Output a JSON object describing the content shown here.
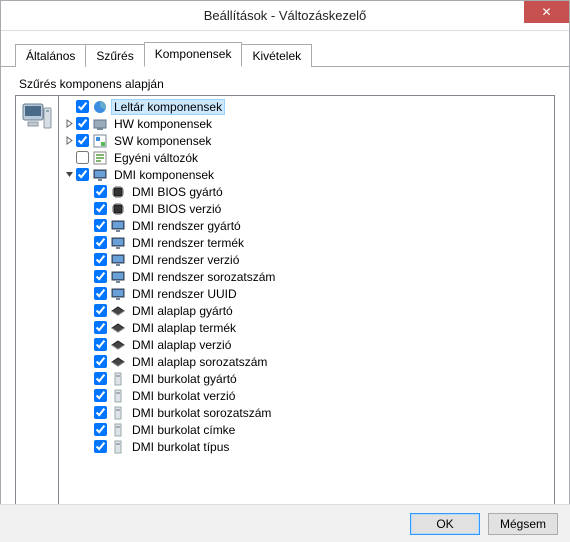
{
  "window": {
    "title": "Beállítások - Változáskezelő",
    "close_label": "✕"
  },
  "tabs": [
    {
      "label": "Általános",
      "active": false
    },
    {
      "label": "Szűrés",
      "active": false
    },
    {
      "label": "Komponensek",
      "active": true
    },
    {
      "label": "Kivételek",
      "active": false
    }
  ],
  "group_label": "Szűrés komponens alapján",
  "tree": [
    {
      "level": 0,
      "expander": "none",
      "checked": true,
      "icon": "pie-icon",
      "label": "Leltár komponensek",
      "selected": true
    },
    {
      "level": 0,
      "expander": "closed",
      "checked": true,
      "icon": "hw-icon",
      "label": "HW komponensek"
    },
    {
      "level": 0,
      "expander": "closed",
      "checked": true,
      "icon": "sw-icon",
      "label": "SW komponensek"
    },
    {
      "level": 0,
      "expander": "none",
      "checked": false,
      "icon": "custom-icon",
      "label": "Egyéni változók"
    },
    {
      "level": 0,
      "expander": "open",
      "checked": true,
      "icon": "monitor-icon",
      "label": "DMI komponensek"
    },
    {
      "level": 1,
      "expander": "none",
      "checked": true,
      "icon": "chip-icon",
      "label": "DMI BIOS gyártó"
    },
    {
      "level": 1,
      "expander": "none",
      "checked": true,
      "icon": "chip-icon",
      "label": "DMI BIOS verzió"
    },
    {
      "level": 1,
      "expander": "none",
      "checked": true,
      "icon": "monitor-icon",
      "label": "DMI rendszer gyártó"
    },
    {
      "level": 1,
      "expander": "none",
      "checked": true,
      "icon": "monitor-icon",
      "label": "DMI rendszer termék"
    },
    {
      "level": 1,
      "expander": "none",
      "checked": true,
      "icon": "monitor-icon",
      "label": "DMI rendszer verzió"
    },
    {
      "level": 1,
      "expander": "none",
      "checked": true,
      "icon": "monitor-icon",
      "label": "DMI rendszer sorozatszám"
    },
    {
      "level": 1,
      "expander": "none",
      "checked": true,
      "icon": "monitor-icon",
      "label": "DMI rendszer UUID"
    },
    {
      "level": 1,
      "expander": "none",
      "checked": true,
      "icon": "board-icon",
      "label": "DMI alaplap gyártó"
    },
    {
      "level": 1,
      "expander": "none",
      "checked": true,
      "icon": "board-icon",
      "label": "DMI alaplap termék"
    },
    {
      "level": 1,
      "expander": "none",
      "checked": true,
      "icon": "board-icon",
      "label": "DMI alaplap verzió"
    },
    {
      "level": 1,
      "expander": "none",
      "checked": true,
      "icon": "board-icon",
      "label": "DMI alaplap sorozatszám"
    },
    {
      "level": 1,
      "expander": "none",
      "checked": true,
      "icon": "case-icon",
      "label": "DMI burkolat gyártó"
    },
    {
      "level": 1,
      "expander": "none",
      "checked": true,
      "icon": "case-icon",
      "label": "DMI burkolat verzió"
    },
    {
      "level": 1,
      "expander": "none",
      "checked": true,
      "icon": "case-icon",
      "label": "DMI burkolat sorozatszám"
    },
    {
      "level": 1,
      "expander": "none",
      "checked": true,
      "icon": "case-icon",
      "label": "DMI burkolat címke"
    },
    {
      "level": 1,
      "expander": "none",
      "checked": true,
      "icon": "case-icon",
      "label": "DMI burkolat típus"
    }
  ],
  "buttons": {
    "ok": "OK",
    "cancel": "Mégsem"
  },
  "colors": {
    "titlebar_close": "#c75050",
    "selection_bg": "#cce8ff",
    "selection_border": "#99d1ff"
  }
}
